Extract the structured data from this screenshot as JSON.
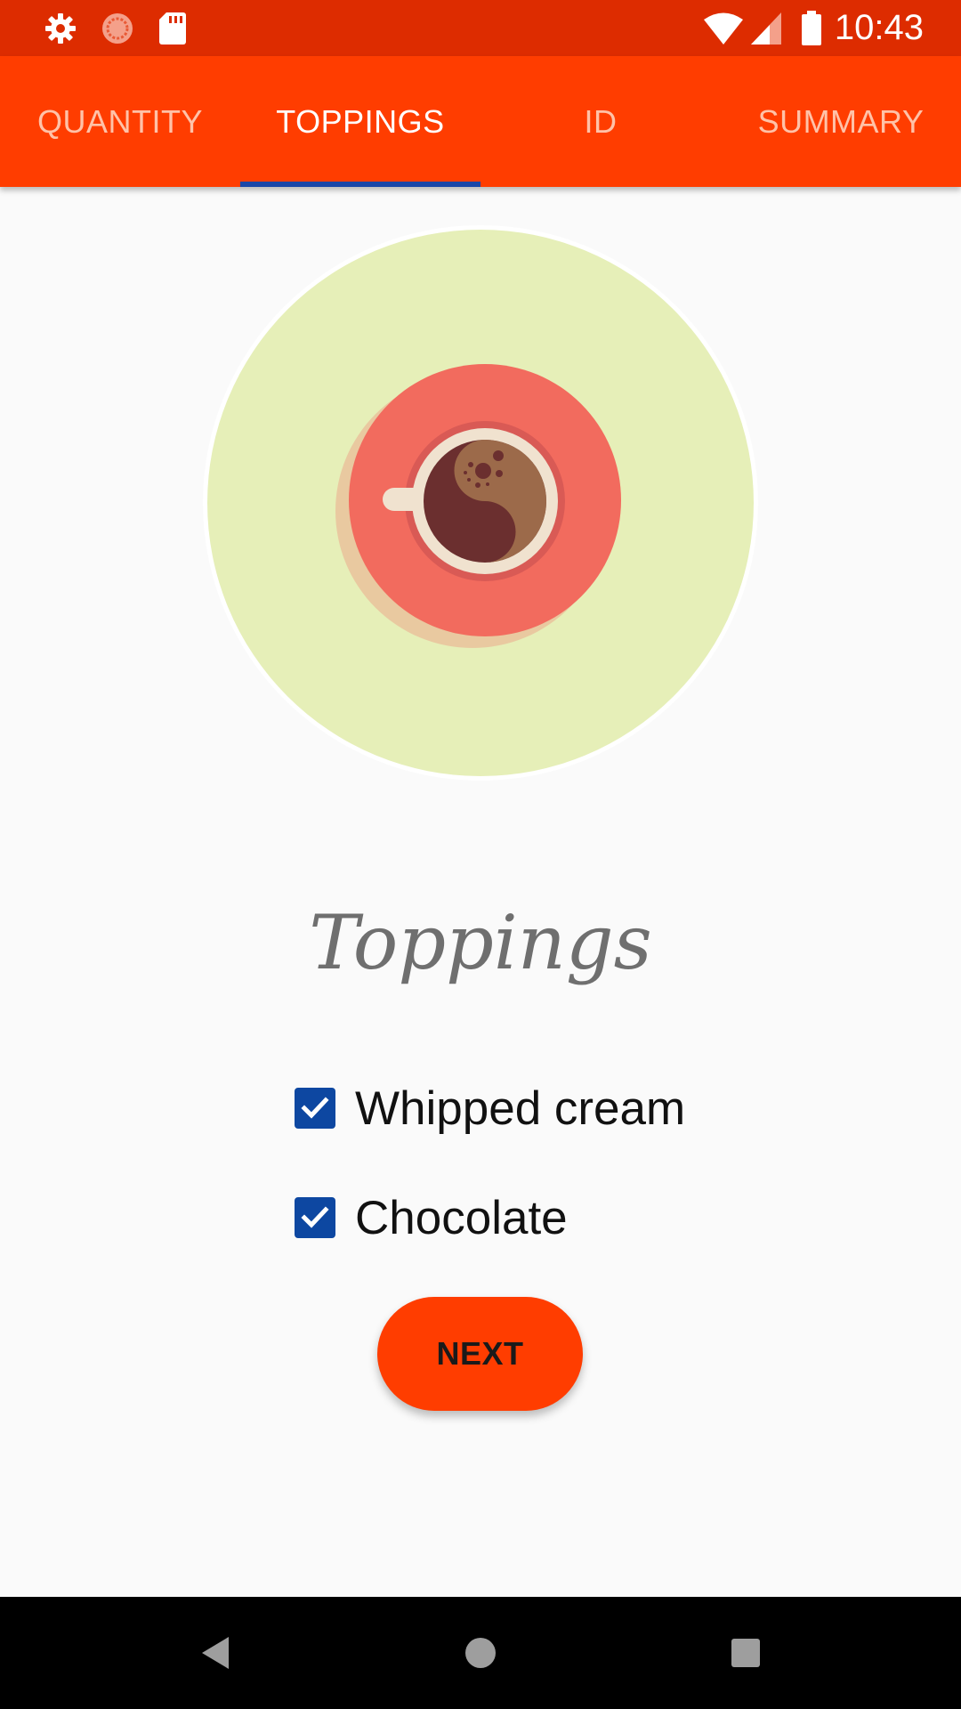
{
  "status_bar": {
    "time": "10:43",
    "left_icons": [
      "gear-icon",
      "data-saver-icon",
      "sd-card-icon"
    ],
    "right_icons": [
      "wifi-icon",
      "cell-signal-icon",
      "battery-icon"
    ]
  },
  "tabs": [
    {
      "label": "QUANTITY",
      "active": false
    },
    {
      "label": "TOPPINGS",
      "active": true
    },
    {
      "label": "ID",
      "active": false
    },
    {
      "label": "SUMMARY",
      "active": false
    }
  ],
  "hero": {
    "icon": "coffee-cup-icon"
  },
  "title": "Toppings",
  "toppings": [
    {
      "label": "Whipped cream",
      "checked": true
    },
    {
      "label": "Chocolate",
      "checked": true
    }
  ],
  "next_button": {
    "label": "NEXT"
  },
  "nav_bar": {
    "icons": [
      "back-icon",
      "home-icon",
      "recents-icon"
    ]
  },
  "colors": {
    "status_bar": "#dd2c00",
    "app_bar": "#ff3d00",
    "tab_indicator": "#1a47a8",
    "checkbox": "#0d47a1",
    "hero_circle": "#e6efb8",
    "saucer": "#f26b5e",
    "background": "#fafafa"
  }
}
